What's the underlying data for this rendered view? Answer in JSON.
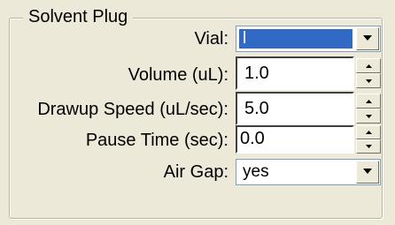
{
  "group": {
    "title": "Solvent Plug"
  },
  "fields": {
    "vial": {
      "label": "Vial:",
      "value": "l",
      "icon": "chevron-down-icon"
    },
    "volume": {
      "label": "Volume (uL):",
      "value": "1.0"
    },
    "drawup_speed": {
      "label": "Drawup Speed (uL/sec):",
      "value": "5.0"
    },
    "pause_time": {
      "label": "Pause Time (sec):",
      "value": "0.0"
    },
    "air_gap": {
      "label": "Air Gap:",
      "value": "yes",
      "icon": "chevron-down-icon"
    }
  },
  "colors": {
    "selection": "#316ac5",
    "background": "#ece9d8"
  }
}
